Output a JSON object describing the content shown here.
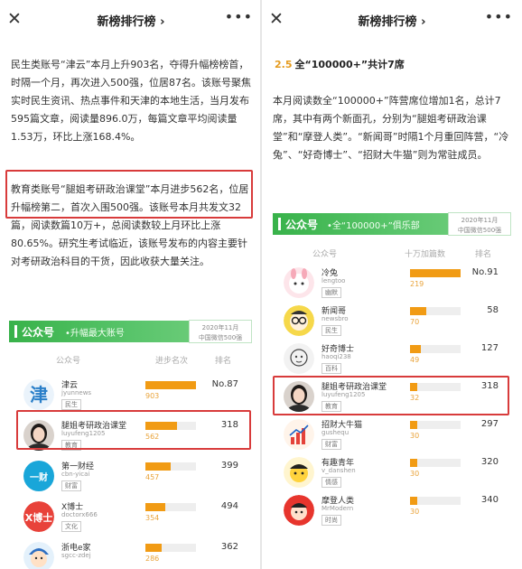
{
  "left": {
    "topbar": {
      "close": "✕",
      "title": "新榜排行榜 ›",
      "more": "•••"
    },
    "para1": "民生类账号“津云”本月上升903名，夺得升幅榜榜首，时隔一个月，再次进入500强，位居87名。该账号聚焦实时民生资讯、热点事件和天津的本地生活，当月发布595篇文章，阅读量896.0万，每篇文章平均阅读量1.53万，环比上涨168.4%。",
    "para2": "教育类账号“腿姐考研政治课堂”本月进步562名，位居升幅榜第二，首次入围500强。该账号本月共发文32篇，阅读数篇10万+，总阅读数较上月环比上涨80.65%。研究生考试临近，该账号发布的内容主要针对考研政治科目的干货，因此收获大量关注。",
    "banner": {
      "brand": "公众号",
      "subtitle": "•升幅最大账号",
      "tag_line1": "2020年11月",
      "tag_line2": "中国微信500强"
    },
    "columns": {
      "account": "公众号",
      "change": "进步名次",
      "rank": "排名"
    },
    "rows": [
      {
        "name": "津云",
        "id": "jyunnews",
        "tag": "民生",
        "value": "903",
        "rank": "No.87",
        "fill": 1.0,
        "avatar": "jin-logo"
      },
      {
        "name": "腿姐考研政治课堂",
        "id": "luyufeng1205",
        "tag": "教育",
        "value": "562",
        "rank": "318",
        "fill": 0.62,
        "avatar": "woman-photo"
      },
      {
        "name": "第一财经",
        "id": "cbn-yicai",
        "tag": "财富",
        "value": "457",
        "rank": "399",
        "fill": 0.5,
        "avatar": "yicai-logo"
      },
      {
        "name": "X博士",
        "id": "doctorx666",
        "tag": "文化",
        "value": "354",
        "rank": "494",
        "fill": 0.39,
        "avatar": "xboshi-logo"
      },
      {
        "name": "浙电e家",
        "id": "sgcc-zdej",
        "tag": "",
        "value": "286",
        "rank": "362",
        "fill": 0.32,
        "avatar": "cartoon-kid"
      }
    ]
  },
  "right": {
    "topbar": {
      "close": "✕",
      "title": "新榜排行榜 ›",
      "more": "•••"
    },
    "heading_num": "2.5",
    "heading_text": "全“100000+”共计7席",
    "para": "本月阅读数全“100000+”阵营席位增加1名，总计7席，其中有两个新面孔，分别为“腿姐考研政治课堂”和“摩登人类”。“新闻哥”时隔1个月重回阵营，“冷兔”、“好奇博士”、“招财大牛猫”则为常驻成员。",
    "banner": {
      "brand": "公众号",
      "subtitle": "•全“100000+”俱乐部",
      "tag_line1": "2020年11月",
      "tag_line2": "中国微信500强"
    },
    "columns": {
      "account": "公众号",
      "count": "十万加篇数",
      "rank": "排名"
    },
    "rows": [
      {
        "name": "冷兔",
        "id": "lengtoo",
        "tag": "幽默",
        "value": "219",
        "rank": "No.91",
        "fill": 1.0,
        "avatar": "pink-cartoon"
      },
      {
        "name": "新闻哥",
        "id": "newsbro",
        "tag": "民生",
        "value": "70",
        "rank": "58",
        "fill": 0.32,
        "avatar": "glasses-cartoon"
      },
      {
        "name": "好奇博士",
        "id": "haoqi238",
        "tag": "百科",
        "value": "49",
        "rank": "127",
        "fill": 0.22,
        "avatar": "sketch-face"
      },
      {
        "name": "腿姐考研政治课堂",
        "id": "luyufeng1205",
        "tag": "教育",
        "value": "32",
        "rank": "318",
        "fill": 0.15,
        "avatar": "woman-photo"
      },
      {
        "name": "招财大牛猫",
        "id": "gushequ",
        "tag": "财富",
        "value": "30",
        "rank": "297",
        "fill": 0.14,
        "avatar": "chart-logo"
      },
      {
        "name": "有趣青年",
        "id": "v_danshen",
        "tag": "情感",
        "value": "30",
        "rank": "320",
        "fill": 0.14,
        "avatar": "yellow-cartoon"
      },
      {
        "name": "摩登人类",
        "id": "MrModern",
        "tag": "时尚",
        "value": "30",
        "rank": "340",
        "fill": 0.14,
        "avatar": "red-cartoon"
      }
    ]
  },
  "colors": {
    "accent_green": "#38b24a",
    "bar_orange": "#f19b14",
    "highlight_red": "#d83b3b"
  }
}
